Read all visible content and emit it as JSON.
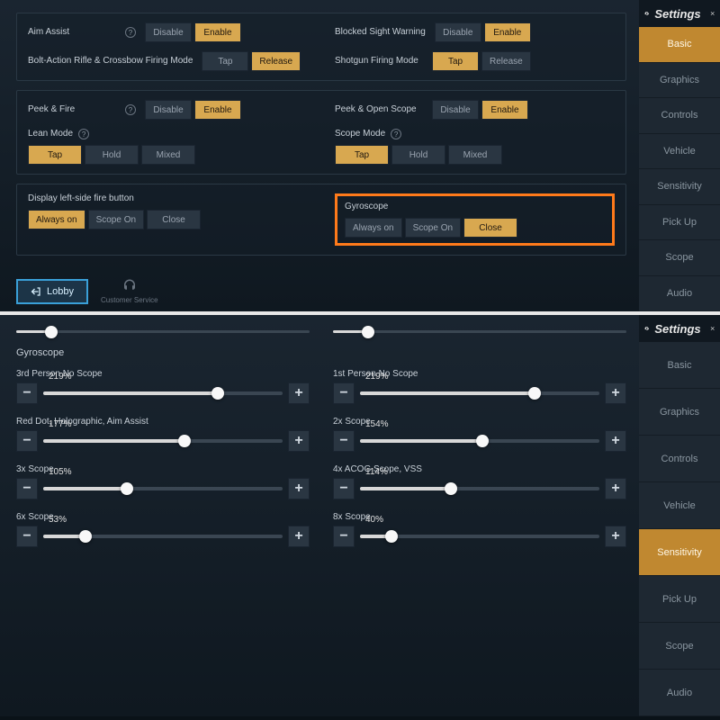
{
  "header": {
    "title": "Settings"
  },
  "menu": {
    "items": [
      "Basic",
      "Graphics",
      "Controls",
      "Vehicle",
      "Sensitivity",
      "Pick Up",
      "Scope",
      "Audio"
    ]
  },
  "top": {
    "active_menu": "Basic",
    "aim_assist": {
      "label": "Aim Assist",
      "options": [
        "Disable",
        "Enable"
      ],
      "active": "Enable"
    },
    "blocked_sight": {
      "label": "Blocked Sight Warning",
      "options": [
        "Disable",
        "Enable"
      ],
      "active": "Enable"
    },
    "bolt_action": {
      "label": "Bolt-Action Rifle & Crossbow Firing Mode",
      "options": [
        "Tap",
        "Release"
      ],
      "active": "Release"
    },
    "shotgun": {
      "label": "Shotgun Firing Mode",
      "options": [
        "Tap",
        "Release"
      ],
      "active": "Tap"
    },
    "peek_fire": {
      "label": "Peek & Fire",
      "options": [
        "Disable",
        "Enable"
      ],
      "active": "Enable"
    },
    "peek_scope": {
      "label": "Peek & Open Scope",
      "options": [
        "Disable",
        "Enable"
      ],
      "active": "Enable"
    },
    "lean_mode": {
      "label": "Lean Mode",
      "options": [
        "Tap",
        "Hold",
        "Mixed"
      ],
      "active": "Tap"
    },
    "scope_mode": {
      "label": "Scope Mode",
      "options": [
        "Tap",
        "Hold",
        "Mixed"
      ],
      "active": "Tap"
    },
    "left_fire": {
      "label": "Display left-side fire button",
      "options": [
        "Always on",
        "Scope On",
        "Close"
      ],
      "active": "Always on"
    },
    "gyroscope": {
      "label": "Gyroscope",
      "options": [
        "Always on",
        "Scope On",
        "Close"
      ],
      "active": "Close"
    },
    "lobby": "Lobby",
    "cs": "Customer Service"
  },
  "bottom": {
    "active_menu": "Sensitivity",
    "section_title": "Gyroscope",
    "sliders": [
      {
        "left": {
          "label": "3rd Person No Scope",
          "value": 219,
          "max": 300
        },
        "right": {
          "label": "1st Person No Scope",
          "value": 219,
          "max": 300
        }
      },
      {
        "left": {
          "label": "Red Dot, Holographic, Aim Assist",
          "value": 177,
          "max": 300
        },
        "right": {
          "label": "2x Scope",
          "value": 154,
          "max": 300
        }
      },
      {
        "left": {
          "label": "3x Scope",
          "value": 105,
          "max": 300
        },
        "right": {
          "label": "4x ACOG Scope, VSS",
          "value": 114,
          "max": 300
        }
      },
      {
        "left": {
          "label": "6x Scope",
          "value": 53,
          "max": 300
        },
        "right": {
          "label": "8x Scope",
          "value": 40,
          "max": 300
        }
      }
    ]
  }
}
